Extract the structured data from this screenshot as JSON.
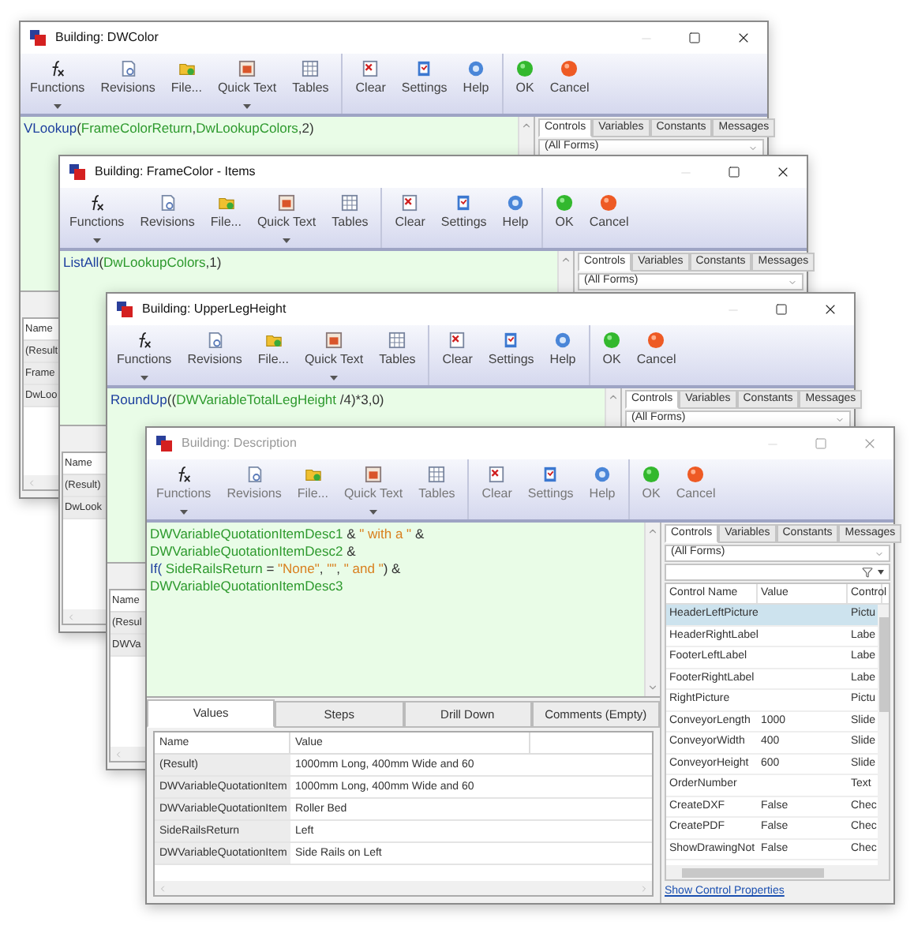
{
  "windows": [
    {
      "title": "Building: DWColor",
      "active": true,
      "toolbar": [
        [
          {
            "kind": "functions",
            "label": "Functions",
            "dropdown": true
          },
          {
            "kind": "revisions",
            "label": "Revisions",
            "dropdown": false
          },
          {
            "kind": "file",
            "label": "File...",
            "dropdown": false
          },
          {
            "kind": "quicktext",
            "label": "Quick Text",
            "dropdown": true
          },
          {
            "kind": "tables",
            "label": "Tables",
            "dropdown": false
          }
        ],
        [
          {
            "kind": "clear",
            "label": "Clear",
            "dropdown": false
          },
          {
            "kind": "settings",
            "label": "Settings",
            "dropdown": false
          },
          {
            "kind": "help",
            "label": "Help",
            "dropdown": false
          }
        ],
        [
          {
            "kind": "ok",
            "label": "OK",
            "dropdown": false
          },
          {
            "kind": "cancel",
            "label": "Cancel",
            "dropdown": false
          }
        ]
      ],
      "formula": [
        [
          {
            "kind": "fn",
            "text": "VLookup"
          },
          {
            "kind": "op",
            "text": "("
          },
          {
            "kind": "var",
            "text": "FrameColorReturn"
          },
          {
            "kind": "op",
            "text": ","
          },
          {
            "kind": "var",
            "text": "DwLookupColors"
          },
          {
            "kind": "op",
            "text": ",2)"
          }
        ]
      ],
      "panel": {
        "tabs": [
          {
            "label": "Controls",
            "selected": true
          },
          {
            "label": "Variables",
            "selected": false
          },
          {
            "label": "Constants",
            "selected": false
          },
          {
            "label": "Messages",
            "selected": false
          }
        ],
        "form_select": "(All Forms)"
      },
      "values": {
        "columns": [
          "Name"
        ],
        "rows": [
          [
            "(Result"
          ],
          [
            "Frame"
          ],
          [
            "DwLoo"
          ]
        ]
      }
    },
    {
      "title": "Building: FrameColor - Items",
      "active": true,
      "toolbar": [
        [
          {
            "kind": "functions",
            "label": "Functions",
            "dropdown": true
          },
          {
            "kind": "revisions",
            "label": "Revisions",
            "dropdown": false
          },
          {
            "kind": "file",
            "label": "File...",
            "dropdown": false
          },
          {
            "kind": "quicktext",
            "label": "Quick Text",
            "dropdown": true
          },
          {
            "kind": "tables",
            "label": "Tables",
            "dropdown": false
          }
        ],
        [
          {
            "kind": "clear",
            "label": "Clear",
            "dropdown": false
          },
          {
            "kind": "settings",
            "label": "Settings",
            "dropdown": false
          },
          {
            "kind": "help",
            "label": "Help",
            "dropdown": false
          }
        ],
        [
          {
            "kind": "ok",
            "label": "OK",
            "dropdown": false
          },
          {
            "kind": "cancel",
            "label": "Cancel",
            "dropdown": false
          }
        ]
      ],
      "formula": [
        [
          {
            "kind": "fn",
            "text": "ListAll"
          },
          {
            "kind": "op",
            "text": "("
          },
          {
            "kind": "var",
            "text": "DwLookupColors"
          },
          {
            "kind": "op",
            "text": ",1)"
          }
        ]
      ],
      "panel": {
        "tabs": [
          {
            "label": "Controls",
            "selected": true
          },
          {
            "label": "Variables",
            "selected": false
          },
          {
            "label": "Constants",
            "selected": false
          },
          {
            "label": "Messages",
            "selected": false
          }
        ],
        "form_select": "(All Forms)"
      },
      "values": {
        "columns": [
          "Name"
        ],
        "rows": [
          [
            "(Result)"
          ],
          [
            "DwLook"
          ]
        ]
      }
    },
    {
      "title": "Building: UpperLegHeight",
      "active": true,
      "toolbar": [
        [
          {
            "kind": "functions",
            "label": "Functions",
            "dropdown": true
          },
          {
            "kind": "revisions",
            "label": "Revisions",
            "dropdown": false
          },
          {
            "kind": "file",
            "label": "File...",
            "dropdown": false
          },
          {
            "kind": "quicktext",
            "label": "Quick Text",
            "dropdown": true
          },
          {
            "kind": "tables",
            "label": "Tables",
            "dropdown": false
          }
        ],
        [
          {
            "kind": "clear",
            "label": "Clear",
            "dropdown": false
          },
          {
            "kind": "settings",
            "label": "Settings",
            "dropdown": false
          },
          {
            "kind": "help",
            "label": "Help",
            "dropdown": false
          }
        ],
        [
          {
            "kind": "ok",
            "label": "OK",
            "dropdown": false
          },
          {
            "kind": "cancel",
            "label": "Cancel",
            "dropdown": false
          }
        ]
      ],
      "formula": [
        [
          {
            "kind": "fn",
            "text": "RoundUp"
          },
          {
            "kind": "op",
            "text": "(("
          },
          {
            "kind": "var",
            "text": "DWVariableTotalLegHeight"
          },
          {
            "kind": "op",
            "text": " /4)*3,0)"
          }
        ]
      ],
      "panel": {
        "tabs": [
          {
            "label": "Controls",
            "selected": true
          },
          {
            "label": "Variables",
            "selected": false
          },
          {
            "label": "Constants",
            "selected": false
          },
          {
            "label": "Messages",
            "selected": false
          }
        ],
        "form_select": "(All Forms)"
      },
      "values": {
        "columns": [
          "Name"
        ],
        "rows": [
          [
            "(Resul"
          ],
          [
            "DWVa"
          ]
        ]
      }
    },
    {
      "title": "Building: Description",
      "active": false,
      "toolbar": [
        [
          {
            "kind": "functions",
            "label": "Functions",
            "dropdown": true
          },
          {
            "kind": "revisions",
            "label": "Revisions",
            "dropdown": false
          },
          {
            "kind": "file",
            "label": "File...",
            "dropdown": false
          },
          {
            "kind": "quicktext",
            "label": "Quick Text",
            "dropdown": true
          },
          {
            "kind": "tables",
            "label": "Tables",
            "dropdown": false
          }
        ],
        [
          {
            "kind": "clear",
            "label": "Clear",
            "dropdown": false
          },
          {
            "kind": "settings",
            "label": "Settings",
            "dropdown": false
          },
          {
            "kind": "help",
            "label": "Help",
            "dropdown": false
          }
        ],
        [
          {
            "kind": "ok",
            "label": "OK",
            "dropdown": false
          },
          {
            "kind": "cancel",
            "label": "Cancel",
            "dropdown": false
          }
        ]
      ],
      "formula": [
        [
          {
            "kind": "var",
            "text": "DWVariableQuotationItemDesc1"
          },
          {
            "kind": "op",
            "text": " & "
          },
          {
            "kind": "str",
            "text": "\" with a \""
          },
          {
            "kind": "op",
            "text": " &"
          }
        ],
        [
          {
            "kind": "var",
            "text": "DWVariableQuotationItemDesc2"
          },
          {
            "kind": "op",
            "text": " &"
          }
        ],
        [
          {
            "kind": "fn",
            "text": "If("
          },
          {
            "kind": "var",
            "text": " SideRailsReturn"
          },
          {
            "kind": "op",
            "text": " = "
          },
          {
            "kind": "str",
            "text": "\"None\""
          },
          {
            "kind": "op",
            "text": ", "
          },
          {
            "kind": "str",
            "text": "\"\""
          },
          {
            "kind": "op",
            "text": ", "
          },
          {
            "kind": "str",
            "text": "\" and \""
          },
          {
            "kind": "op",
            "text": ") &"
          }
        ],
        [
          {
            "kind": "var",
            "text": "DWVariableQuotationItemDesc3"
          }
        ]
      ],
      "bottom_tabs": [
        {
          "label": "Values",
          "selected": true
        },
        {
          "label": "Steps",
          "selected": false
        },
        {
          "label": "Drill Down",
          "selected": false
        },
        {
          "label": "Comments (Empty)",
          "selected": false
        }
      ],
      "panel": {
        "tabs": [
          {
            "label": "Controls",
            "selected": true
          },
          {
            "label": "Variables",
            "selected": false
          },
          {
            "label": "Constants",
            "selected": false
          },
          {
            "label": "Messages",
            "selected": false
          }
        ],
        "form_select": "(All Forms)",
        "grid": {
          "columns": [
            "Control Name",
            "Value",
            "Control"
          ],
          "rows": [
            {
              "cells": [
                "HeaderLeftPicture",
                "",
                "Pictu"
              ],
              "selected": true
            },
            {
              "cells": [
                "HeaderRightLabel",
                "",
                "Labe"
              ],
              "selected": false
            },
            {
              "cells": [
                "FooterLeftLabel",
                "",
                "Labe"
              ],
              "selected": false
            },
            {
              "cells": [
                "FooterRightLabel",
                "",
                "Labe"
              ],
              "selected": false
            },
            {
              "cells": [
                "RightPicture",
                "",
                "Pictu"
              ],
              "selected": false
            },
            {
              "cells": [
                "ConveyorLength",
                "1000",
                "Slide"
              ],
              "selected": false
            },
            {
              "cells": [
                "ConveyorWidth",
                "400",
                "Slide"
              ],
              "selected": false
            },
            {
              "cells": [
                "ConveyorHeight",
                "600",
                "Slide"
              ],
              "selected": false
            },
            {
              "cells": [
                "OrderNumber",
                "",
                "Text"
              ],
              "selected": false
            },
            {
              "cells": [
                "CreateDXF",
                "False",
                "Chec"
              ],
              "selected": false
            },
            {
              "cells": [
                "CreatePDF",
                "False",
                "Chec"
              ],
              "selected": false
            },
            {
              "cells": [
                "ShowDrawingNot",
                "False",
                "Chec"
              ],
              "selected": false
            }
          ]
        },
        "link": "Show Control Properties"
      },
      "values": {
        "columns": [
          "Name",
          "Value"
        ],
        "rows": [
          [
            "(Result)",
            "1000mm Long, 400mm Wide and 60"
          ],
          [
            "DWVariableQuotationItem",
            "1000mm Long, 400mm Wide and 60"
          ],
          [
            "DWVariableQuotationItem",
            "Roller Bed"
          ],
          [
            "SideRailsReturn",
            "Left"
          ],
          [
            "DWVariableQuotationItem",
            "Side Rails on Left"
          ]
        ]
      }
    }
  ]
}
